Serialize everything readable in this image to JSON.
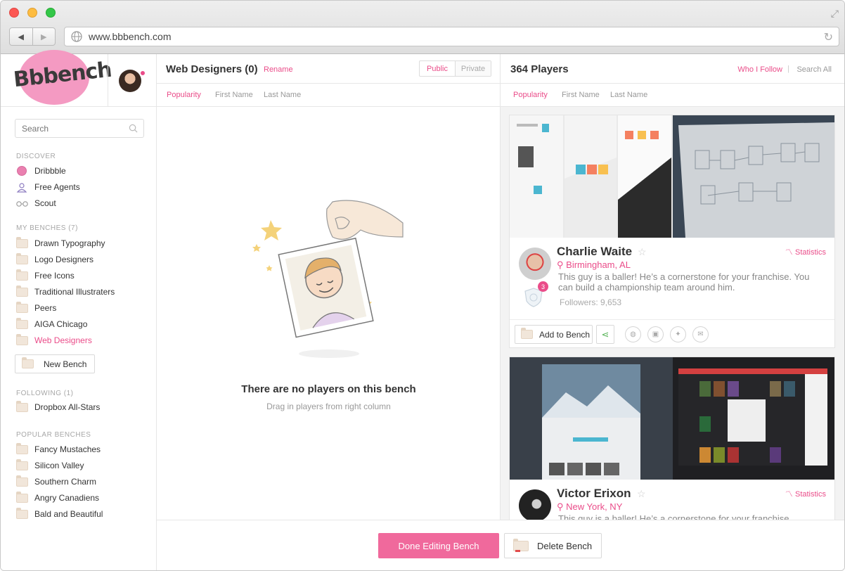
{
  "browser": {
    "url": "www.bbbench.com"
  },
  "brand": {
    "logo_text": "Bbbench",
    "accent": "#ea4c89"
  },
  "sidebar": {
    "search_placeholder": "Search",
    "discover_label": "DISCOVER",
    "discover": [
      {
        "label": "Dribbble",
        "icon": "dribbble-ball-icon"
      },
      {
        "label": "Free Agents",
        "icon": "person-icon"
      },
      {
        "label": "Scout",
        "icon": "glasses-icon"
      }
    ],
    "my_benches_label": "MY BENCHES (7)",
    "my_benches": [
      "Drawn Typography",
      "Logo Designers",
      "Free Icons",
      "Traditional Illustraters",
      "Peers",
      "AIGA Chicago",
      "Web Designers"
    ],
    "active_bench": "Web Designers",
    "new_bench_label": "New Bench",
    "following_label": "FOLLOWING (1)",
    "following": [
      "Dropbox All-Stars"
    ],
    "popular_label": "POPULAR BENCHES",
    "popular": [
      "Fancy Mustaches",
      "Silicon Valley",
      "Southern Charm",
      "Angry Canadiens",
      "Bald and Beautiful"
    ]
  },
  "bench": {
    "title": "Web Designers (0)",
    "rename_label": "Rename",
    "public_label": "Public",
    "private_label": "Private",
    "sort": [
      "Popularity",
      "First Name",
      "Last Name"
    ],
    "empty_title": "There are no players on this bench",
    "empty_subtitle": "Drag in players from right column"
  },
  "players": {
    "title": "364 Players",
    "who_i_follow": "Who I Follow",
    "separator": "|",
    "search_all": "Search All",
    "sort": [
      "Popularity",
      "First Name",
      "Last Name"
    ],
    "statistics_label": "Statistics",
    "add_to_bench_label": "Add to Bench",
    "cards": [
      {
        "name": "Charlie Waite",
        "location": "Birmingham, AL",
        "bio": "This guy is a baller! He’s a cornerstone for your franchise. You can build a championship team around him.",
        "followers": "Followers: 9,653",
        "badge_count": "3"
      },
      {
        "name": "Victor Erixon",
        "location": "New York, NY",
        "bio": "This guy is a baller! He’s a cornerstone for your franchise."
      }
    ]
  },
  "footer": {
    "done_label": "Done Editing Bench",
    "delete_label": "Delete Bench"
  }
}
